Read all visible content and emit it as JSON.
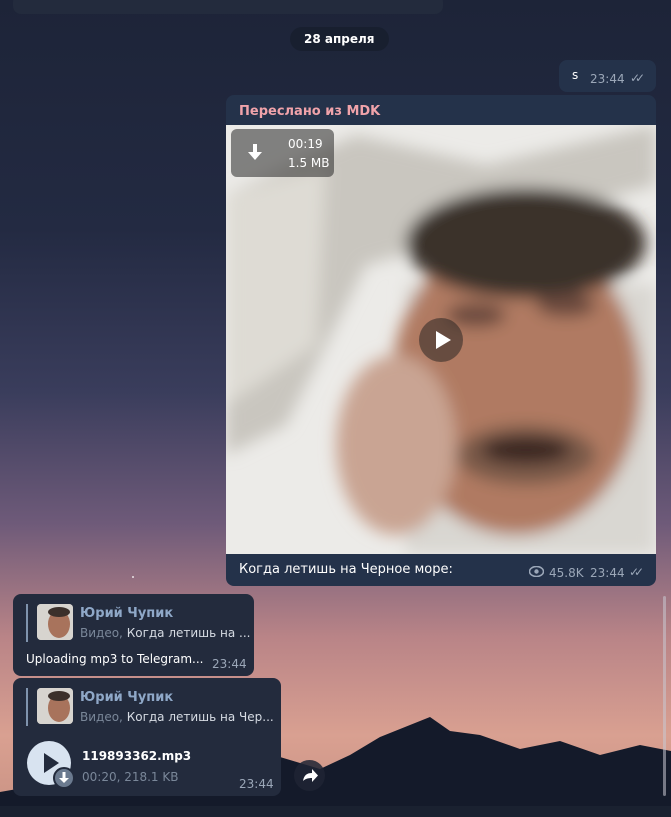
{
  "date_separator": "28 апреля",
  "messages": {
    "s_msg": {
      "text": "s",
      "time": "23:44"
    },
    "forwarded_video": {
      "forwarded_label": "Переслано из MDK",
      "duration": "00:19",
      "size": "1.5 MB",
      "caption": "Когда летишь на Черное море:",
      "views": "45.8K",
      "time": "23:44"
    },
    "reply1": {
      "reply_author": "Юрий Чупик",
      "reply_kind": "Видео,",
      "reply_text": "Когда летишь на ...",
      "text": "Uploading mp3 to Telegram...",
      "time": "23:44"
    },
    "reply2": {
      "reply_author": "Юрий Чупик",
      "reply_kind": "Видео,",
      "reply_text": "Когда летишь на Чер...",
      "audio_name": "119893362.mp3",
      "audio_meta": "00:20, 218.1 KB",
      "time": "23:44"
    }
  },
  "icons": {
    "read_checks": "double-check-icon",
    "download": "download-icon",
    "play": "play-icon",
    "views": "eye-icon",
    "share": "share-icon"
  },
  "colors": {
    "outgoing_bubble": "#24324a",
    "incoming_bubble": "#232b3d",
    "forwarded_label": "#f0a3aa",
    "reply_author": "#8fa8c8"
  }
}
